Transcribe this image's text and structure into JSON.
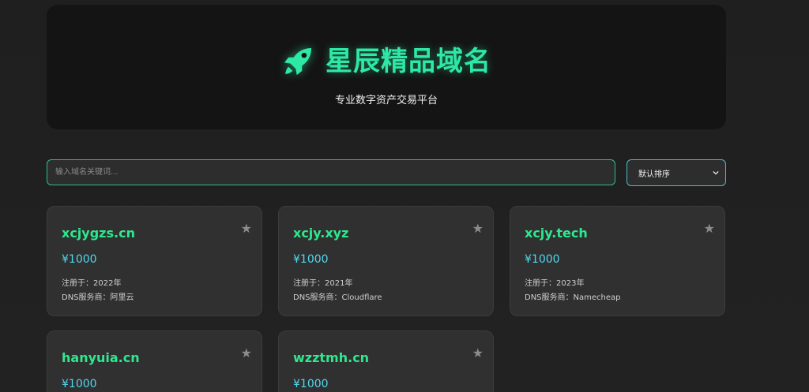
{
  "header": {
    "title": "星辰精品域名",
    "subtitle": "专业数字资产交易平台",
    "logo_icon": "rocket-icon",
    "accent_color": "#2ee8a6"
  },
  "search": {
    "placeholder": "输入域名关键词...",
    "value": ""
  },
  "sort": {
    "selected": "默认排序"
  },
  "labels": {
    "registered_prefix": "注册于：",
    "dns_prefix": "DNS服务商："
  },
  "domains": [
    {
      "name": "xcjygzs.cn",
      "price": "¥1000",
      "registered": "2022年",
      "dns": "阿里云",
      "favorite_icon": "★"
    },
    {
      "name": "xcjy.xyz",
      "price": "¥1000",
      "registered": "2021年",
      "dns": "Cloudflare",
      "favorite_icon": "★"
    },
    {
      "name": "xcjy.tech",
      "price": "¥1000",
      "registered": "2023年",
      "dns": "Namecheap",
      "favorite_icon": "★"
    },
    {
      "name": "hanyuia.cn",
      "price": "¥1000",
      "favorite_icon": "★"
    },
    {
      "name": "wzztmh.cn",
      "price": "¥1000",
      "favorite_icon": "★"
    }
  ]
}
